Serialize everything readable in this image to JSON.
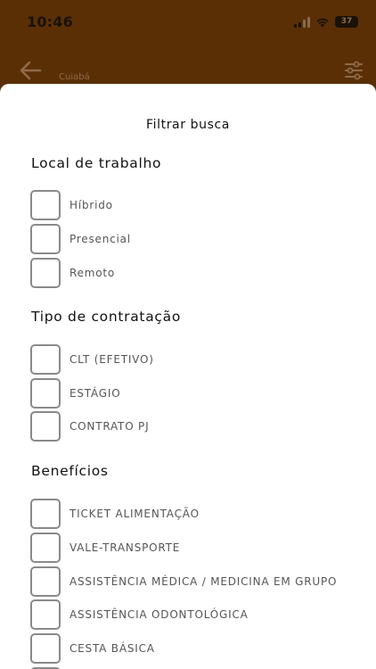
{
  "status_bar": {
    "time": "10:46",
    "battery": "37"
  },
  "header": {
    "subtitle": "Cuiabá"
  },
  "sheet": {
    "title": "Filtrar busca",
    "sections": [
      {
        "title": "Local de trabalho",
        "options": [
          {
            "label": "Híbrido",
            "checked": false
          },
          {
            "label": "Presencial",
            "checked": false
          },
          {
            "label": "Remoto",
            "checked": false
          }
        ]
      },
      {
        "title": "Tipo de contratação",
        "options": [
          {
            "label": "CLT (EFETIVO)",
            "checked": false
          },
          {
            "label": "ESTÁGIO",
            "checked": false
          },
          {
            "label": "CONTRATO PJ",
            "checked": false
          }
        ]
      },
      {
        "title": "Benefícios",
        "options": [
          {
            "label": "TICKET ALIMENTAÇÃO",
            "checked": false
          },
          {
            "label": "VALE-TRANSPORTE",
            "checked": false
          },
          {
            "label": "ASSISTÊNCIA MÉDICA / MEDICINA EM GRUPO",
            "checked": false
          },
          {
            "label": "ASSISTÊNCIA ODONTOLÓGICA",
            "checked": false
          },
          {
            "label": "CESTA BÁSICA",
            "checked": false
          },
          {
            "label": "",
            "checked": false
          }
        ]
      }
    ]
  },
  "colors": {
    "header_bg": "#5a2f06",
    "sheet_bg": "#ffffff",
    "checkbox_border": "#8a8a8a"
  }
}
